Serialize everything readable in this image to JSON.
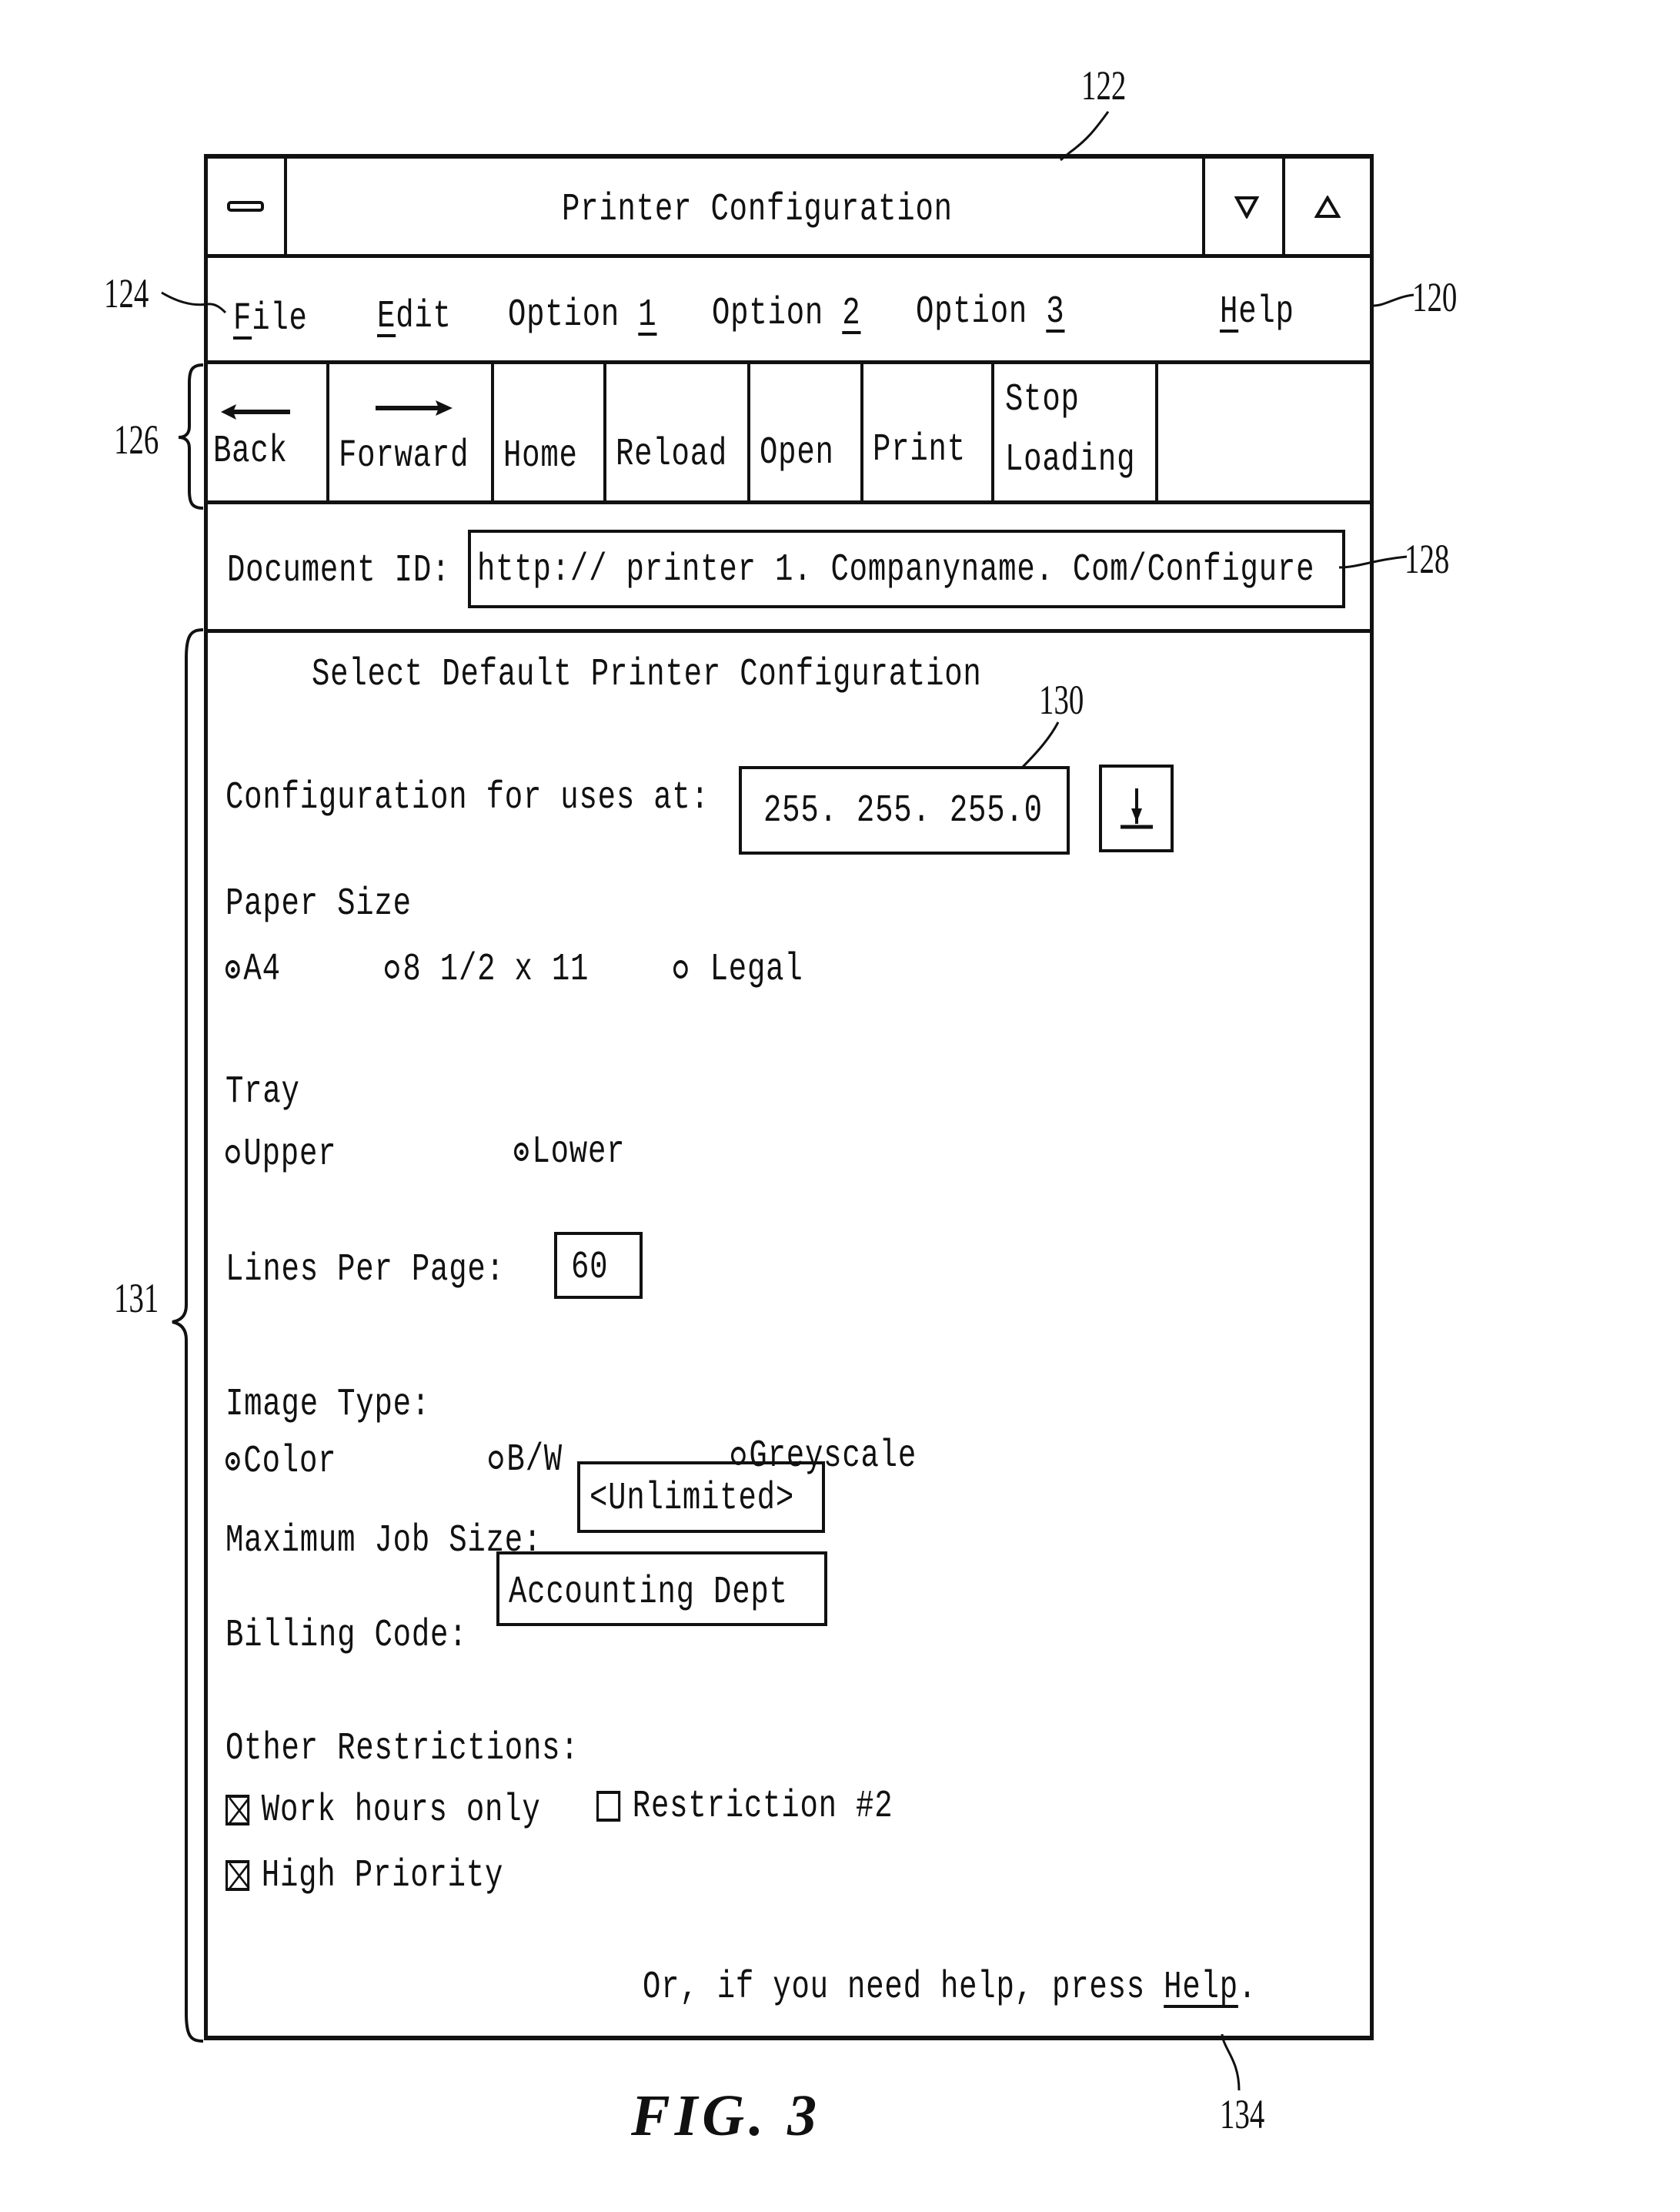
{
  "window": {
    "title": "Printer Configuration",
    "system_menu_icon": "minimize-bar-icon",
    "scroll_down_icon": "triangle-down-icon",
    "scroll_up_icon": "triangle-up-icon"
  },
  "menu_bar": {
    "items": [
      {
        "label": "File",
        "mnemonic": "F"
      },
      {
        "label": "Edit",
        "mnemonic": "E"
      },
      {
        "label": "Option 1",
        "mnemonic": "1"
      },
      {
        "label": "Option 2",
        "mnemonic": "2"
      },
      {
        "label": "Option 3",
        "mnemonic": "3"
      },
      {
        "label": "Help",
        "mnemonic": "H"
      }
    ]
  },
  "toolbar": {
    "buttons": [
      {
        "label": "Back",
        "icon": "arrow-left-icon"
      },
      {
        "label": "Forward",
        "icon": "arrow-right-icon"
      },
      {
        "label": "Home"
      },
      {
        "label": "Reload"
      },
      {
        "label": "Open"
      },
      {
        "label": "Print"
      },
      {
        "label_line1": "Stop",
        "label_line2": "Loading"
      }
    ]
  },
  "address": {
    "label": "Document ID:",
    "value": "http:// printer 1. Companyname. Com/Configure"
  },
  "content": {
    "heading": "Select Default Printer Configuration",
    "config_for": {
      "label": "Configuration for uses at:",
      "value": "255. 255. 255.0",
      "dropdown_icon": "download-arrow-icon"
    },
    "paper_size": {
      "label": "Paper Size",
      "options": [
        {
          "label": "A4",
          "selected": true
        },
        {
          "label": "8 1/2 x 11",
          "selected": false
        },
        {
          "label": "Legal",
          "selected": false
        }
      ]
    },
    "tray": {
      "label": "Tray",
      "options": [
        {
          "label": "Upper",
          "selected": false
        },
        {
          "label": "Lower",
          "selected": true
        }
      ]
    },
    "lines_per_page": {
      "label": "Lines Per Page:",
      "value": "60"
    },
    "image_type": {
      "label": "Image Type:",
      "options": [
        {
          "label": "Color",
          "selected": true
        },
        {
          "label": "B/W",
          "selected": false
        },
        {
          "label": "Greyscale",
          "selected": false
        }
      ]
    },
    "max_job_size": {
      "label": "Maximum Job Size:",
      "value": "<Unlimited>"
    },
    "billing_code": {
      "label": "Billing Code:",
      "value": "Accounting Dept"
    },
    "other_restrictions": {
      "label": "Other Restrictions:",
      "options": [
        {
          "label": "Work hours only",
          "checked": true
        },
        {
          "label": "Restriction #2",
          "checked": false
        },
        {
          "label": "High Priority",
          "checked": true
        }
      ]
    },
    "help_text_prefix": "Or, if you need help, press ",
    "help_link": "Help",
    "help_text_suffix": "."
  },
  "annotations": {
    "ref_122": "122",
    "ref_124": "124",
    "ref_120": "120",
    "ref_126": "126",
    "ref_128": "128",
    "ref_130": "130",
    "ref_131": "131",
    "ref_134": "134",
    "figure_caption": "FIG. 3"
  }
}
